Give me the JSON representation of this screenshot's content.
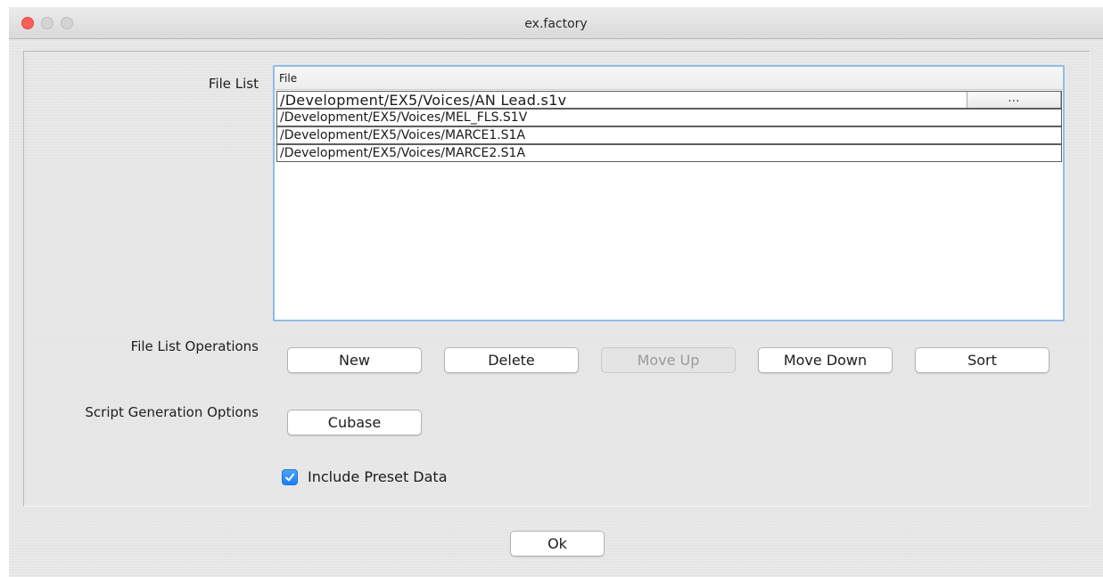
{
  "window": {
    "title": "ex.factory"
  },
  "file_list": {
    "label": "File List",
    "column_header": "File",
    "browse_label": "...",
    "rows": [
      "/Development/EX5/Voices/AN  Lead.s1v",
      "/Development/EX5/Voices/MEL_FLS.S1V",
      "/Development/EX5/Voices/MARCE1.S1A",
      "/Development/EX5/Voices/MARCE2.S1A"
    ]
  },
  "operations": {
    "label": "File List Operations",
    "new": "New",
    "delete": "Delete",
    "move_up": "Move Up",
    "move_down": "Move Down",
    "sort": "Sort"
  },
  "script_options": {
    "label": "Script Generation Options",
    "cubase": "Cubase",
    "include_preset_label": "Include Preset Data",
    "include_preset_checked": true
  },
  "footer": {
    "ok": "Ok"
  },
  "colors": {
    "accent": "#1f7ff2",
    "close": "#fc5f57",
    "list_border": "#8fbde8"
  }
}
